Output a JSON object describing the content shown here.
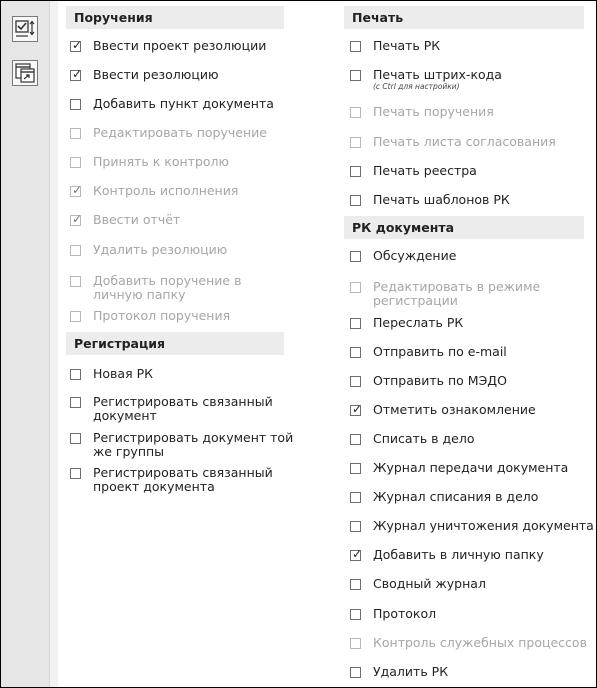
{
  "toolbar": {
    "icon1": "checklist-sort-icon",
    "icon2": "window-export-icon"
  },
  "left": {
    "header1": "Поручения",
    "items1": [
      {
        "label": "Ввести проект резолюции",
        "checked": true,
        "disabled": false
      },
      {
        "label": "Ввести резолюцию",
        "checked": true,
        "disabled": false
      },
      {
        "label": "Добавить пункт документа",
        "checked": false,
        "disabled": false
      },
      {
        "label": "Редактировать поручение",
        "checked": false,
        "disabled": true
      },
      {
        "label": "Принять к контролю",
        "checked": false,
        "disabled": true
      },
      {
        "label": "Контроль исполнения",
        "checked": true,
        "disabled": true
      },
      {
        "label": "Ввести отчёт",
        "checked": true,
        "disabled": true
      },
      {
        "label": "Удалить резолюцию",
        "checked": false,
        "disabled": true
      },
      {
        "label": "Добавить поручение в личную папку",
        "checked": false,
        "disabled": true
      },
      {
        "label": "Протокол поручения",
        "checked": false,
        "disabled": true
      }
    ],
    "header2": "Регистрация",
    "items2": [
      {
        "label": "Новая РК",
        "checked": false,
        "disabled": false
      },
      {
        "label": "Регистрировать связанный документ",
        "checked": false,
        "disabled": false
      },
      {
        "label": "Регистрировать документ той же группы",
        "checked": false,
        "disabled": false
      },
      {
        "label": "Регистрировать связанный проект документа",
        "checked": false,
        "disabled": false
      }
    ]
  },
  "right": {
    "header1": "Печать",
    "items1": [
      {
        "label": "Печать РК",
        "checked": false,
        "disabled": false
      },
      {
        "label": "Печать штрих-кода",
        "hint": "(с Ctrl для настройки)",
        "checked": false,
        "disabled": false
      },
      {
        "label": "Печать поручения",
        "checked": false,
        "disabled": true
      },
      {
        "label": "Печать листа согласования",
        "checked": false,
        "disabled": true
      },
      {
        "label": "Печать реестра",
        "checked": false,
        "disabled": false
      },
      {
        "label": "Печать шаблонов РК",
        "checked": false,
        "disabled": false
      }
    ],
    "header2": "РК документа",
    "items2": [
      {
        "label": "Обсуждение",
        "checked": false,
        "disabled": false
      },
      {
        "label": "Редактировать в режиме регистрации",
        "checked": false,
        "disabled": true
      },
      {
        "label": "Переслать РК",
        "checked": false,
        "disabled": false
      },
      {
        "label": "Отправить по e-mail",
        "checked": false,
        "disabled": false
      },
      {
        "label": "Отправить по МЭДО",
        "checked": false,
        "disabled": false
      },
      {
        "label": "Отметить ознакомление",
        "checked": true,
        "disabled": false
      },
      {
        "label": "Списать в дело",
        "checked": false,
        "disabled": false
      },
      {
        "label": "Журнал передачи документа",
        "checked": false,
        "disabled": false
      },
      {
        "label": "Журнал списания в дело",
        "checked": false,
        "disabled": false
      },
      {
        "label": "Журнал уничтожения документа",
        "checked": false,
        "disabled": false
      },
      {
        "label": "Добавить в личную папку",
        "checked": true,
        "disabled": false
      },
      {
        "label": "Сводный журнал",
        "checked": false,
        "disabled": false
      },
      {
        "label": "Протокол",
        "checked": false,
        "disabled": false
      },
      {
        "label": "Контроль служебных процессов",
        "checked": false,
        "disabled": true
      },
      {
        "label": "Удалить РК",
        "checked": false,
        "disabled": false
      }
    ]
  }
}
